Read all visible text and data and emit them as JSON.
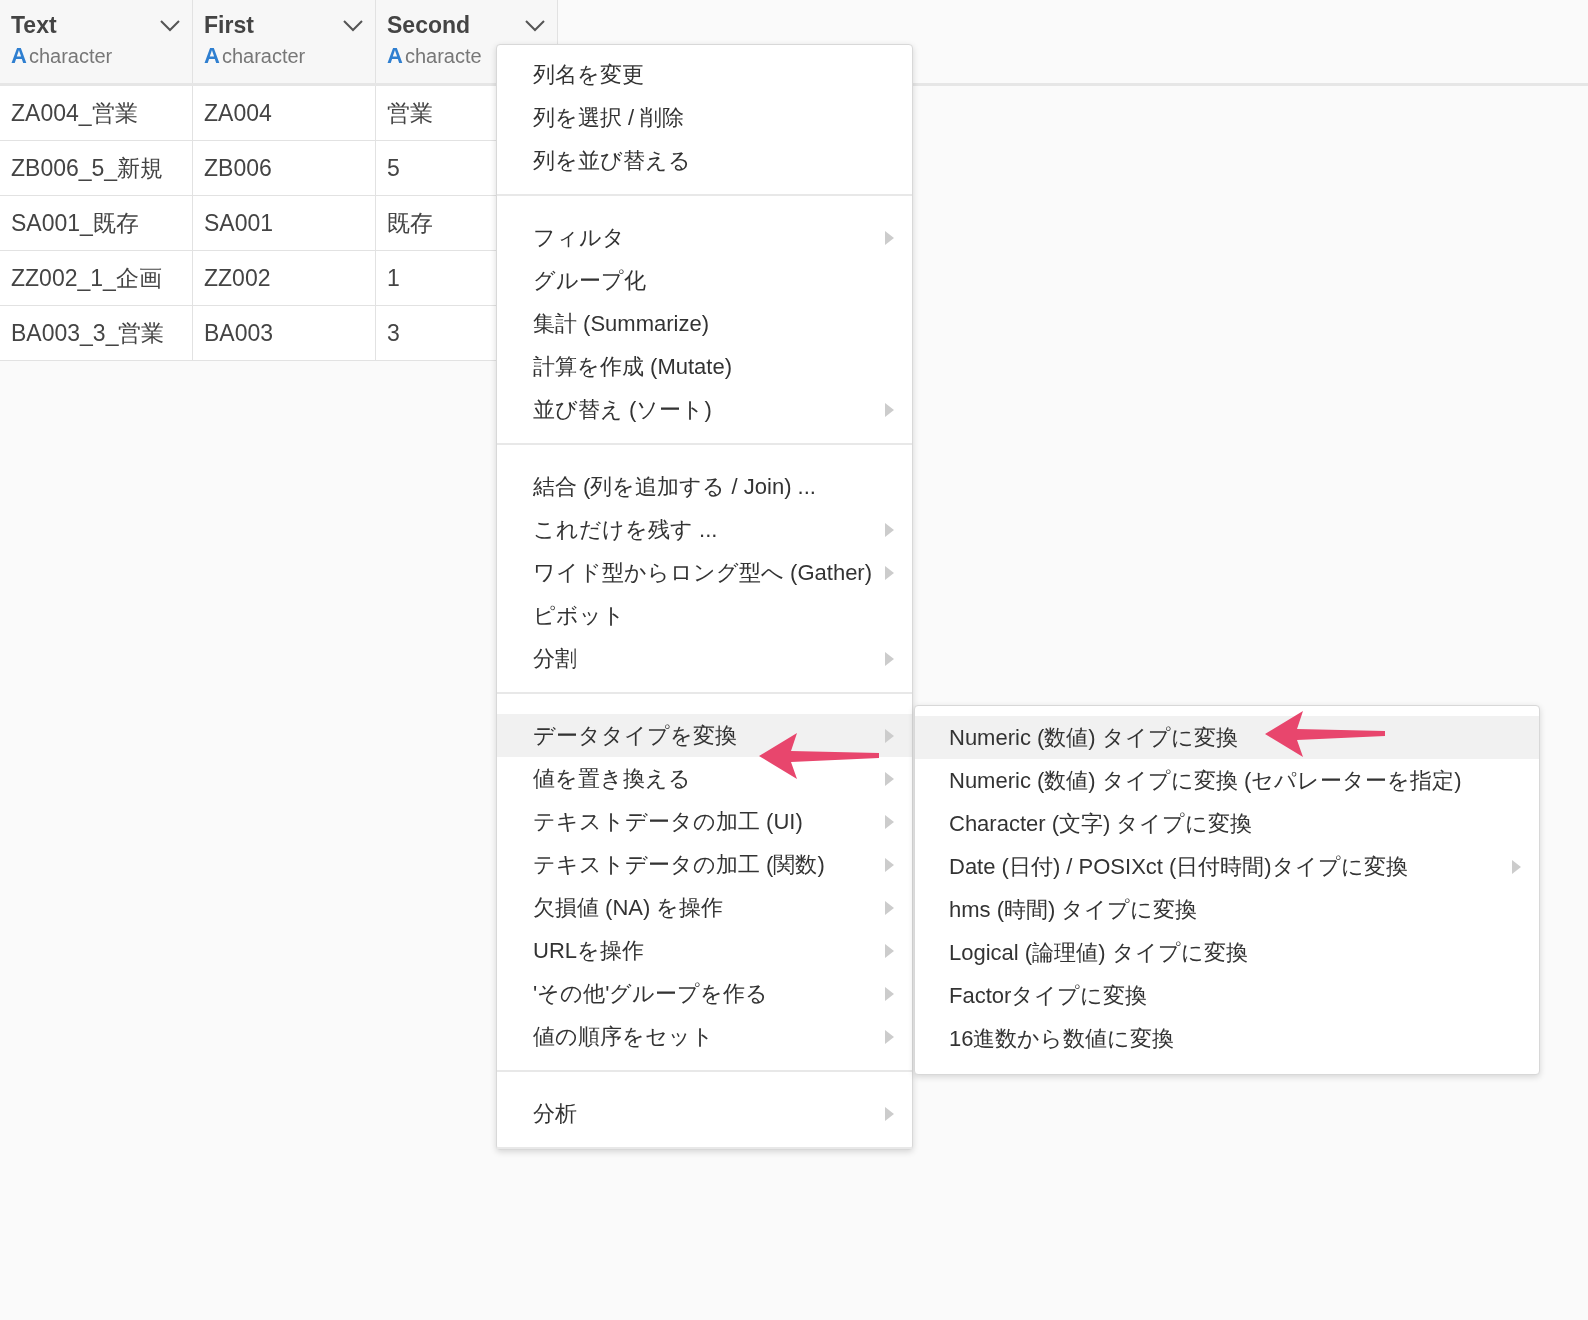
{
  "table": {
    "columns": [
      {
        "name": "Text",
        "badge": "A",
        "type": "character"
      },
      {
        "name": "First",
        "badge": "A",
        "type": "character"
      },
      {
        "name": "Second",
        "badge": "A",
        "type": "characte"
      }
    ],
    "rows": [
      [
        "ZA004_営業",
        "ZA004",
        "営業"
      ],
      [
        "ZB006_5_新規",
        "ZB006",
        "5"
      ],
      [
        "SA001_既存",
        "SA001",
        "既存"
      ],
      [
        "ZZ002_1_企画",
        "ZZ002",
        "1"
      ],
      [
        "BA003_3_営業",
        "BA003",
        "3"
      ]
    ]
  },
  "context_menu": {
    "groups": [
      [
        {
          "label": "列名を変更",
          "submenu": false,
          "selected": false
        },
        {
          "label": "列を選択 / 削除",
          "submenu": false,
          "selected": false
        },
        {
          "label": "列を並び替える",
          "submenu": false,
          "selected": false
        }
      ],
      [
        {
          "label": "フィルタ",
          "submenu": true,
          "selected": false
        },
        {
          "label": "グループ化",
          "submenu": false,
          "selected": false
        },
        {
          "label": "集計 (Summarize)",
          "submenu": false,
          "selected": false
        },
        {
          "label": "計算を作成 (Mutate)",
          "submenu": false,
          "selected": false
        },
        {
          "label": "並び替え (ソート)",
          "submenu": true,
          "selected": false
        }
      ],
      [
        {
          "label": "結合 (列を追加する / Join) ...",
          "submenu": false,
          "selected": false
        },
        {
          "label": "これだけを残す ...",
          "submenu": true,
          "selected": false
        },
        {
          "label": "ワイド型からロング型へ (Gather)",
          "submenu": true,
          "selected": false
        },
        {
          "label": "ピボット",
          "submenu": false,
          "selected": false
        },
        {
          "label": "分割",
          "submenu": true,
          "selected": false
        }
      ],
      [
        {
          "label": "データタイプを変換",
          "submenu": true,
          "selected": true
        },
        {
          "label": "値を置き換える",
          "submenu": true,
          "selected": false
        },
        {
          "label": "テキストデータの加工 (UI)",
          "submenu": true,
          "selected": false
        },
        {
          "label": "テキストデータの加工 (関数)",
          "submenu": true,
          "selected": false
        },
        {
          "label": "欠損値 (NA) を操作",
          "submenu": true,
          "selected": false
        },
        {
          "label": "URLを操作",
          "submenu": true,
          "selected": false
        },
        {
          "label": "'その他'グループを作る",
          "submenu": true,
          "selected": false
        },
        {
          "label": "値の順序をセット",
          "submenu": true,
          "selected": false
        }
      ],
      [
        {
          "label": "分析",
          "submenu": true,
          "selected": false
        }
      ]
    ]
  },
  "submenu": {
    "items": [
      {
        "label": "Numeric (数値) タイプに変換",
        "submenu": false,
        "selected": true
      },
      {
        "label": "Numeric (数値) タイプに変換 (セパレーターを指定)",
        "submenu": false,
        "selected": false
      },
      {
        "label": "Character (文字) タイプに変換",
        "submenu": false,
        "selected": false
      },
      {
        "label": "Date (日付) / POSIXct (日付時間)タイプに変換",
        "submenu": true,
        "selected": false
      },
      {
        "label": "hms (時間) タイプに変換",
        "submenu": false,
        "selected": false
      },
      {
        "label": "Logical (論理値) タイプに変換",
        "submenu": false,
        "selected": false
      },
      {
        "label": "Factorタイプに変換",
        "submenu": false,
        "selected": false
      },
      {
        "label": "16進数から数値に変換",
        "submenu": false,
        "selected": false
      }
    ]
  }
}
